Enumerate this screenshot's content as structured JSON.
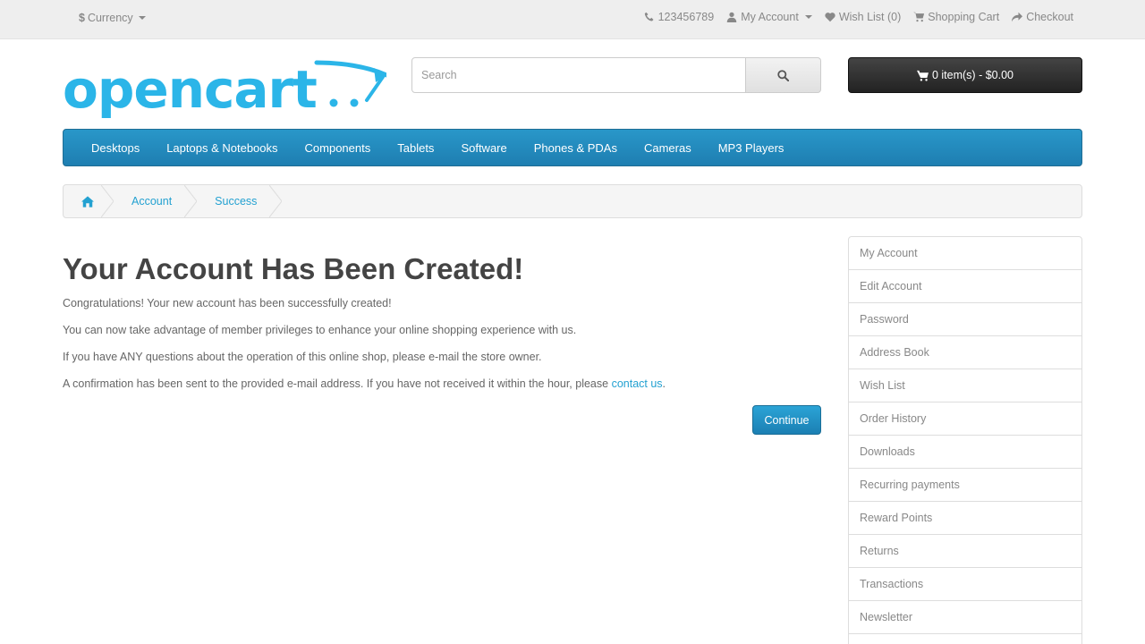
{
  "topbar": {
    "currency_symbol": "$",
    "currency_label": "Currency",
    "phone": "123456789",
    "my_account": "My Account",
    "wish_list": "Wish List (0)",
    "shopping_cart": "Shopping Cart",
    "checkout": "Checkout"
  },
  "search": {
    "placeholder": "Search"
  },
  "cart": {
    "label": "0 item(s) - $0.00"
  },
  "menu": [
    "Desktops",
    "Laptops & Notebooks",
    "Components",
    "Tablets",
    "Software",
    "Phones & PDAs",
    "Cameras",
    "MP3 Players"
  ],
  "breadcrumb": {
    "account": "Account",
    "success": "Success"
  },
  "content": {
    "title": "Your Account Has Been Created!",
    "p1": "Congratulations! Your new account has been successfully created!",
    "p2": "You can now take advantage of member privileges to enhance your online shopping experience with us.",
    "p3": "If you have ANY questions about the operation of this online shop, please e-mail the store owner.",
    "p4_prefix": "A confirmation has been sent to the provided e-mail address. If you have not received it within the hour, please ",
    "p4_link": "contact us",
    "p4_suffix": ".",
    "continue": "Continue"
  },
  "sidebar": [
    "My Account",
    "Edit Account",
    "Password",
    "Address Book",
    "Wish List",
    "Order History",
    "Downloads",
    "Recurring payments",
    "Reward Points",
    "Returns",
    "Transactions",
    "Newsletter",
    ""
  ],
  "colors": {
    "accent": "#23a1d1",
    "menu": "#2292c5",
    "cart": "#2b2b2b"
  }
}
